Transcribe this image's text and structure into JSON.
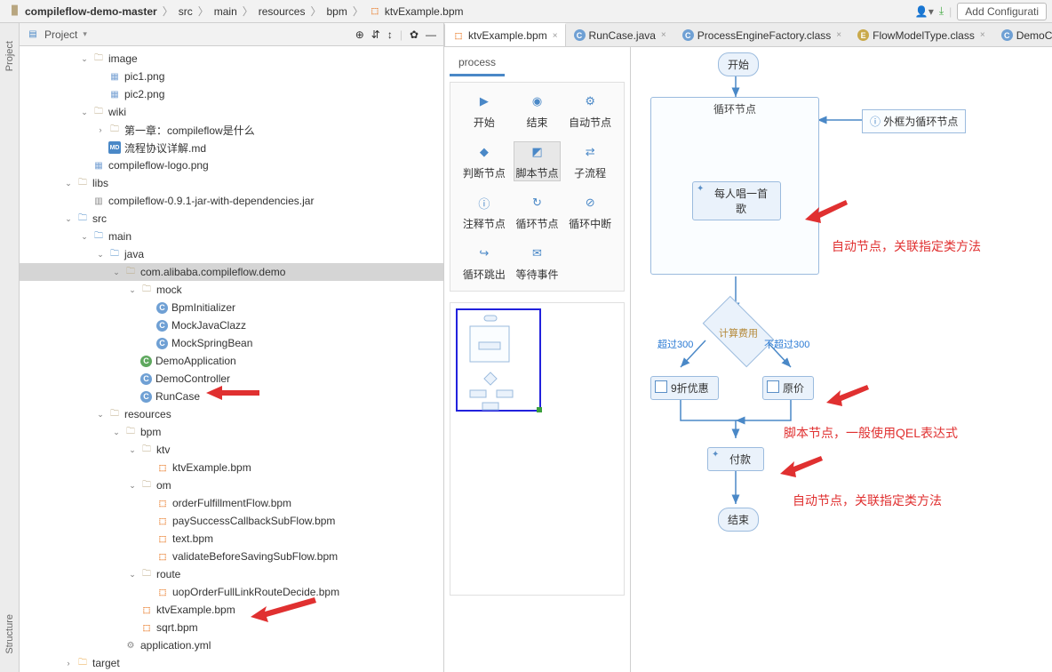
{
  "breadcrumb": [
    "compileflow-demo-master",
    "src",
    "main",
    "resources",
    "bpm",
    "ktvExample.bpm"
  ],
  "topbar": {
    "add_config": "Add Configurati"
  },
  "sidebar": {
    "project": "Project",
    "structure": "Structure"
  },
  "project_panel": {
    "title": "Project"
  },
  "tree": [
    {
      "d": 1,
      "a": "v",
      "ic": "folder",
      "t": "image"
    },
    {
      "d": 2,
      "a": "",
      "ic": "img",
      "t": "pic1.png"
    },
    {
      "d": 2,
      "a": "",
      "ic": "img",
      "t": "pic2.png"
    },
    {
      "d": 1,
      "a": "v",
      "ic": "folder",
      "t": "wiki"
    },
    {
      "d": 2,
      "a": ">",
      "ic": "folder",
      "t": "第一章：compileflow是什么"
    },
    {
      "d": 2,
      "a": "",
      "ic": "md",
      "t": "流程协议详解.md"
    },
    {
      "d": 1,
      "a": "",
      "ic": "img",
      "t": "compileflow-logo.png"
    },
    {
      "d": 0,
      "a": "v",
      "ic": "folder",
      "t": "libs"
    },
    {
      "d": 1,
      "a": "",
      "ic": "jar",
      "t": "compileflow-0.9.1-jar-with-dependencies.jar"
    },
    {
      "d": 0,
      "a": "v",
      "ic": "folderb",
      "t": "src"
    },
    {
      "d": 1,
      "a": "v",
      "ic": "folderb",
      "t": "main"
    },
    {
      "d": 2,
      "a": "v",
      "ic": "folderb",
      "t": "java"
    },
    {
      "d": 3,
      "a": "v",
      "ic": "folder",
      "t": "com.alibaba.compileflow.demo",
      "sel": true
    },
    {
      "d": 4,
      "a": "v",
      "ic": "folder",
      "t": "mock"
    },
    {
      "d": 5,
      "a": "",
      "ic": "c",
      "t": "BpmInitializer"
    },
    {
      "d": 5,
      "a": "",
      "ic": "c",
      "t": "MockJavaClazz"
    },
    {
      "d": 5,
      "a": "",
      "ic": "c",
      "t": "MockSpringBean"
    },
    {
      "d": 4,
      "a": "",
      "ic": "cg",
      "t": "DemoApplication"
    },
    {
      "d": 4,
      "a": "",
      "ic": "c",
      "t": "DemoController"
    },
    {
      "d": 4,
      "a": "",
      "ic": "c",
      "t": "RunCase"
    },
    {
      "d": 2,
      "a": "v",
      "ic": "folder",
      "t": "resources"
    },
    {
      "d": 3,
      "a": "v",
      "ic": "folder",
      "t": "bpm"
    },
    {
      "d": 4,
      "a": "v",
      "ic": "folder",
      "t": "ktv"
    },
    {
      "d": 5,
      "a": "",
      "ic": "bpm",
      "t": "ktvExample.bpm"
    },
    {
      "d": 4,
      "a": "v",
      "ic": "folder",
      "t": "om"
    },
    {
      "d": 5,
      "a": "",
      "ic": "bpm",
      "t": "orderFulfillmentFlow.bpm"
    },
    {
      "d": 5,
      "a": "",
      "ic": "bpm",
      "t": "paySuccessCallbackSubFlow.bpm"
    },
    {
      "d": 5,
      "a": "",
      "ic": "bpm",
      "t": "text.bpm"
    },
    {
      "d": 5,
      "a": "",
      "ic": "bpm",
      "t": "validateBeforeSavingSubFlow.bpm"
    },
    {
      "d": 4,
      "a": "v",
      "ic": "folder",
      "t": "route"
    },
    {
      "d": 5,
      "a": "",
      "ic": "bpm",
      "t": "uopOrderFullLinkRouteDecide.bpm"
    },
    {
      "d": 4,
      "a": "",
      "ic": "bpm",
      "t": "ktvExample.bpm"
    },
    {
      "d": 4,
      "a": "",
      "ic": "bpm",
      "t": "sqrt.bpm"
    },
    {
      "d": 3,
      "a": "",
      "ic": "yml",
      "t": "application.yml"
    },
    {
      "d": 0,
      "a": ">",
      "ic": "foldero",
      "t": "target"
    }
  ],
  "tabs": [
    {
      "ic": "bpm",
      "t": "ktvExample.bpm",
      "act": true
    },
    {
      "ic": "c",
      "t": "RunCase.java"
    },
    {
      "ic": "c",
      "t": "ProcessEngineFactory.class"
    },
    {
      "ic": "e",
      "t": "FlowModelType.class"
    },
    {
      "ic": "c",
      "t": "DemoC"
    }
  ],
  "palette": {
    "header": "process",
    "items": [
      {
        "ic": "▶",
        "t": "开始"
      },
      {
        "ic": "◉",
        "t": "结束"
      },
      {
        "ic": "⚙",
        "t": "自动节点"
      },
      {
        "ic": "◆",
        "t": "判断节点"
      },
      {
        "ic": "◩",
        "t": "脚本节点",
        "sel": true
      },
      {
        "ic": "⇄",
        "t": "子流程"
      },
      {
        "ic": "ⓘ",
        "t": "注释节点"
      },
      {
        "ic": "↻",
        "t": "循环节点"
      },
      {
        "ic": "⊘",
        "t": "循环中断"
      },
      {
        "ic": "↪",
        "t": "循环跳出"
      },
      {
        "ic": "✉",
        "t": "等待事件"
      }
    ]
  },
  "flow": {
    "start": "开始",
    "loop": "循环节点",
    "sing": "每人唱一首歌",
    "info": "外框为循环节点",
    "calc": "计算费用",
    "gt": "超过300",
    "lte": "不超过300",
    "disc": "9折优惠",
    "orig": "原价",
    "pay": "付款",
    "end": "结束"
  },
  "annotations": {
    "a1": "自动节点，关联指定类方法",
    "a2": "脚本节点，一般使用QEL表达式",
    "a3": "自动节点，关联指定类方法"
  }
}
